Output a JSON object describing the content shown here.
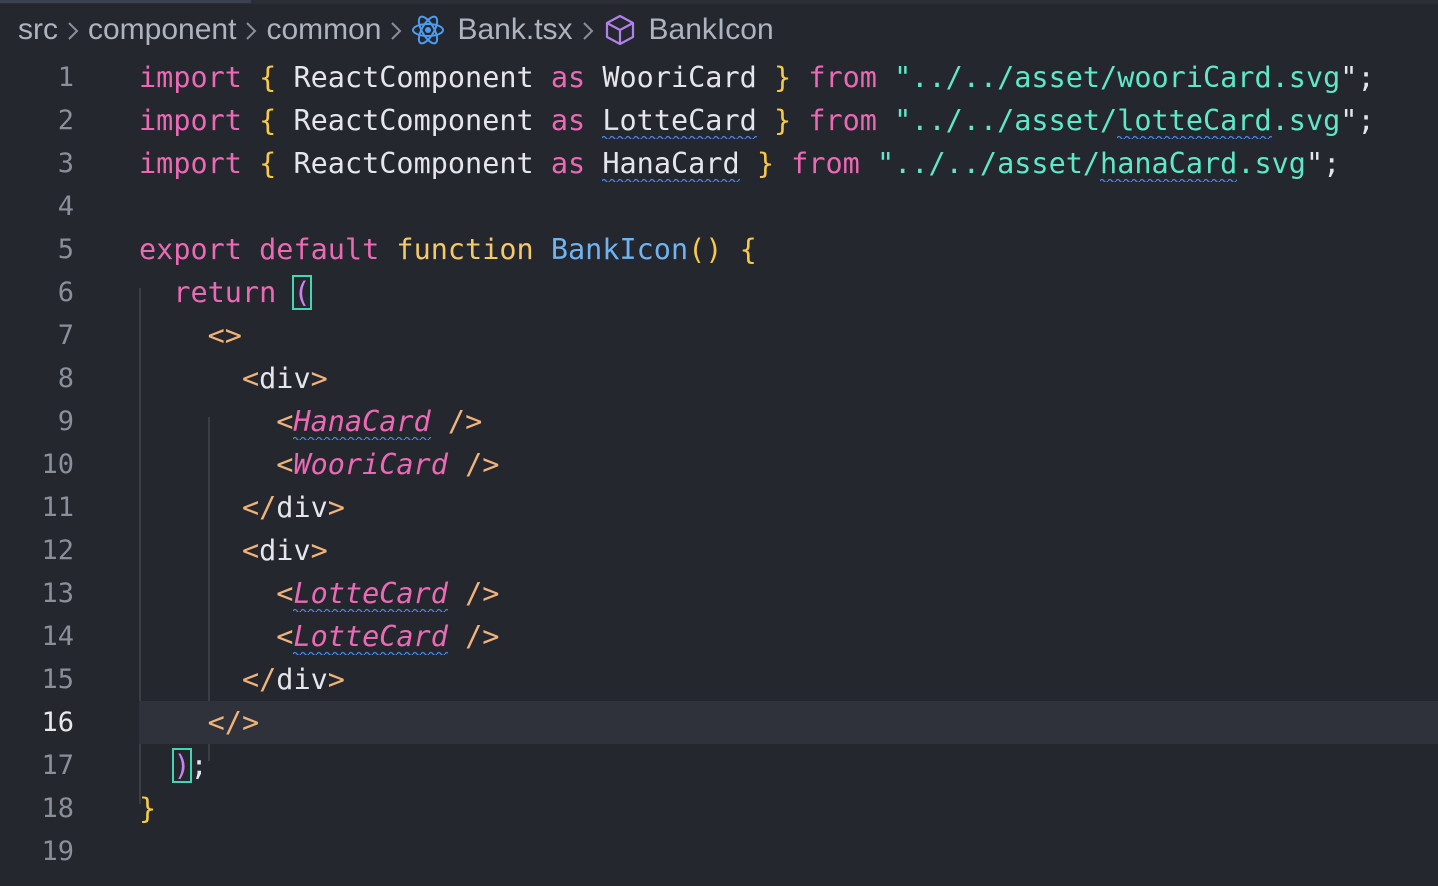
{
  "breadcrumb": {
    "items": [
      {
        "label": "src",
        "icon": null
      },
      {
        "label": "component",
        "icon": null
      },
      {
        "label": "common",
        "icon": null
      },
      {
        "label": "Bank.tsx",
        "icon": "react-icon"
      },
      {
        "label": "BankIcon",
        "icon": "symbol-cube-icon"
      }
    ],
    "separator_icon": "chevron-right-icon"
  },
  "editor": {
    "current_line": 16,
    "line_numbers": [
      "1",
      "2",
      "3",
      "4",
      "5",
      "6",
      "7",
      "8",
      "9",
      "10",
      "11",
      "12",
      "13",
      "14",
      "15",
      "16",
      "17",
      "18",
      "19"
    ],
    "lines": {
      "l1": {
        "kw_import": "import",
        "ob": "{",
        "comp": "ReactComponent",
        "kw_as": "as",
        "alias": "WooriCard",
        "cb": "}",
        "kw_from": "from",
        "q1": "\"",
        "path_a": "../../asset/",
        "path_b": "wooriCard",
        "path_c": ".svg",
        "q2": "\"",
        "semi": ";"
      },
      "l2": {
        "kw_import": "import",
        "ob": "{",
        "comp": "ReactComponent",
        "kw_as": "as",
        "alias": "LotteCard",
        "cb": "}",
        "kw_from": "from",
        "q1": "\"",
        "path_a": "../../asset/",
        "path_b": "lotteCard",
        "path_c": ".svg",
        "q2": "\"",
        "semi": ";"
      },
      "l3": {
        "kw_import": "import",
        "ob": "{",
        "comp": "ReactComponent",
        "kw_as": "as",
        "alias": "HanaCard",
        "cb": "}",
        "kw_from": "from",
        "q1": "\"",
        "path_a": "../../asset/",
        "path_b": "hanaCard",
        "path_c": ".svg",
        "q2": "\"",
        "semi": ";"
      },
      "l5": {
        "kw_export": "export",
        "kw_default": "default",
        "kw_function": "function",
        "fname": "BankIcon",
        "parens": "()",
        "ob": "{"
      },
      "l6": {
        "kw_return": "return",
        "open_paren": "("
      },
      "l7": {
        "frag_open": "<>"
      },
      "l8": {
        "lt": "<",
        "tag": "div",
        "gt": ">"
      },
      "l9": {
        "lt": "<",
        "tag": "HanaCard",
        "close": "/>"
      },
      "l10": {
        "lt": "<",
        "tag": "WooriCard",
        "close": "/>"
      },
      "l11": {
        "lt": "</",
        "tag": "div",
        "gt": ">"
      },
      "l12": {
        "lt": "<",
        "tag": "div",
        "gt": ">"
      },
      "l13": {
        "lt": "<",
        "tag": "LotteCard",
        "close": "/>"
      },
      "l14": {
        "lt": "<",
        "tag": "LotteCard",
        "close": "/>"
      },
      "l15": {
        "lt": "</",
        "tag": "div",
        "gt": ">"
      },
      "l16": {
        "frag_close": "</>"
      },
      "l17": {
        "close_paren": ")",
        "semi": ";"
      },
      "l18": {
        "cb": "}"
      }
    }
  },
  "colors": {
    "background": "#24272e",
    "current_line_bg": "#2f323b",
    "keyword": "#ec69b5",
    "string": "#5ee8c7",
    "function_name": "#6fb3f2",
    "brace": "#f7c948",
    "bracket_match_border": "#43d6b0",
    "squiggle": "#4a86f0"
  }
}
